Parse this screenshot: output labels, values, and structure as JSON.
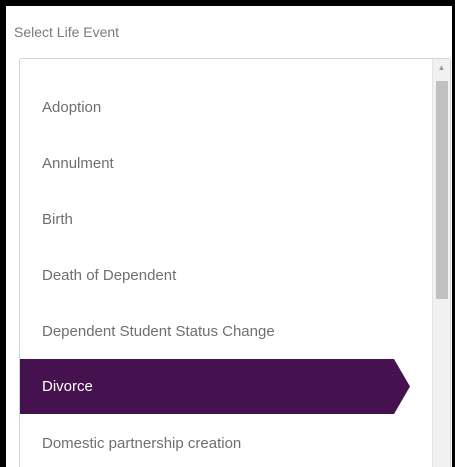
{
  "title": "Select Life Event",
  "items": [
    {
      "label": "Adoption",
      "selected": false
    },
    {
      "label": "Annulment",
      "selected": false
    },
    {
      "label": "Birth",
      "selected": false
    },
    {
      "label": "Death of Dependent",
      "selected": false
    },
    {
      "label": "Dependent Student Status Change",
      "selected": false
    },
    {
      "label": "Divorce",
      "selected": true
    },
    {
      "label": "Domestic partnership creation",
      "selected": false
    }
  ],
  "scrollbar": {
    "up_arrow": "▲"
  },
  "colors": {
    "selected_bg": "#45124f",
    "selected_text": "#ffffff",
    "item_text": "#6f6f6f"
  }
}
